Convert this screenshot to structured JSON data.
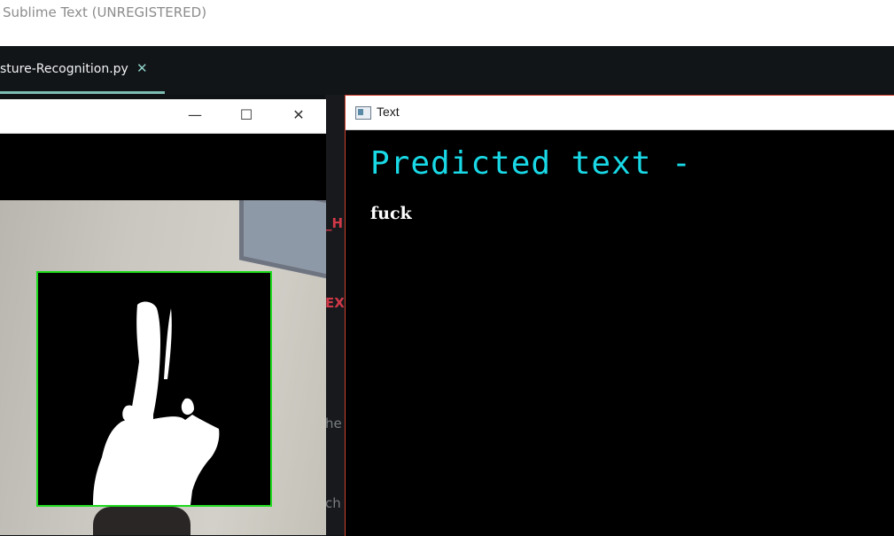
{
  "editor": {
    "app_title": "Sublime Text (UNREGISTERED)",
    "active_tab": "sture-Recognition.py",
    "tab_close": "✕",
    "fragments": [
      "_H",
      "EX",
      "he",
      "ch"
    ]
  },
  "cam_window": {
    "minimize": "—",
    "maximize": "☐",
    "close": "✕"
  },
  "text_window": {
    "title": "Text",
    "predicted_label": "Predicted text -",
    "predicted_value": "fuck"
  },
  "colors": {
    "roi_border": "#1edc1e",
    "predicted_label": "#19d9e6",
    "tab_underline": "#7dbdb3"
  }
}
